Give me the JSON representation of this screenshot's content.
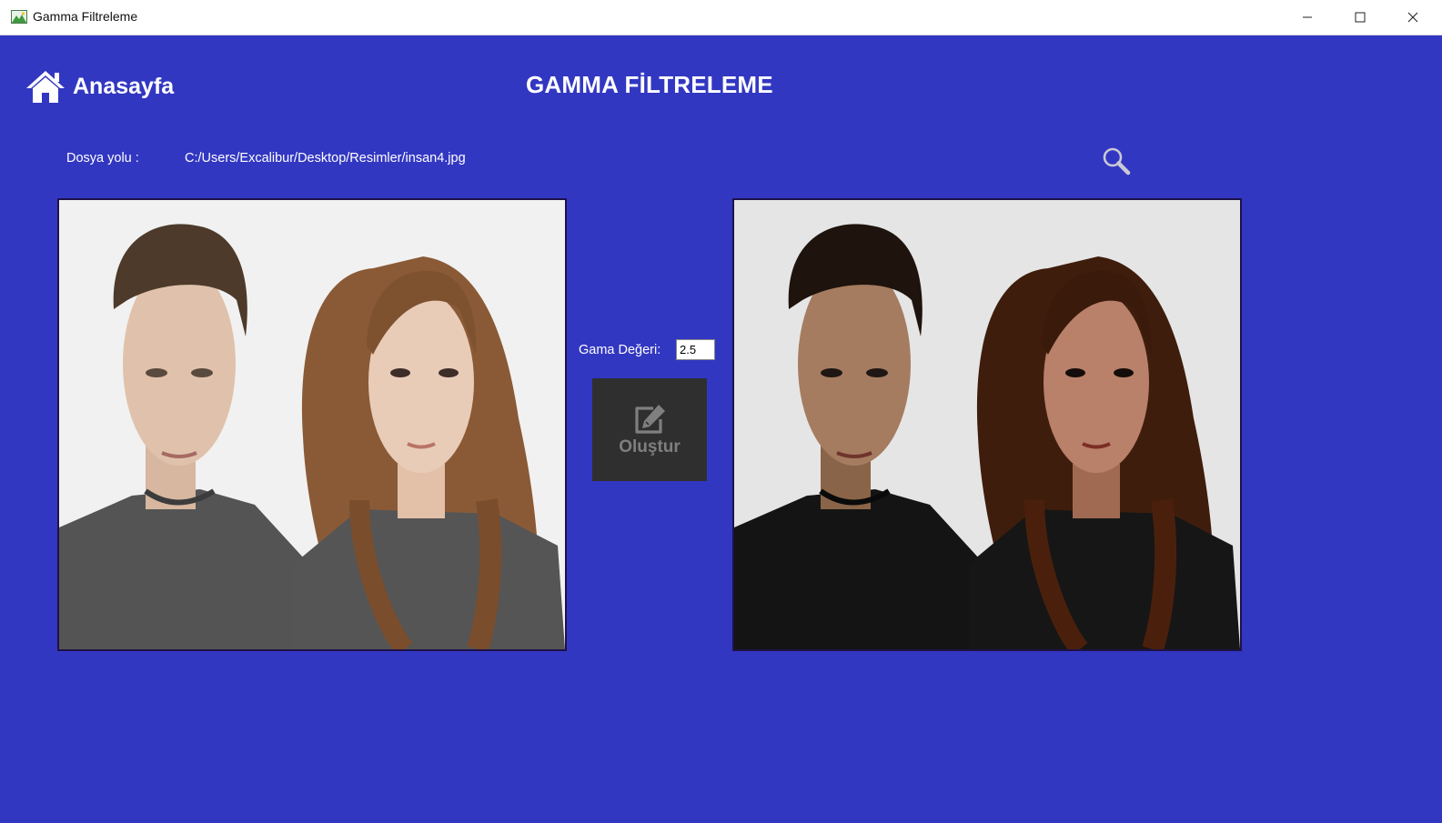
{
  "window": {
    "title": "Gamma Filtreleme",
    "controls": [
      "minimize-icon",
      "maximize-icon",
      "close-icon"
    ]
  },
  "nav": {
    "home_label": "Anasayfa",
    "home_icon": "home-icon"
  },
  "page": {
    "title": "GAMMA FİLTRELEME",
    "background_color": "#3237c2"
  },
  "file": {
    "path_label": "Dosya yolu :",
    "path_value": "C:/Users/Excalibur/Desktop/Resimler/insan4.jpg",
    "browse_icon": "search-icon"
  },
  "gamma": {
    "label": "Gama Değeri:",
    "value": "2.5"
  },
  "create_button": {
    "label": "Oluştur",
    "icon": "edit-icon"
  },
  "images": {
    "original": "original-photo",
    "result": "gamma-filtered-photo"
  }
}
